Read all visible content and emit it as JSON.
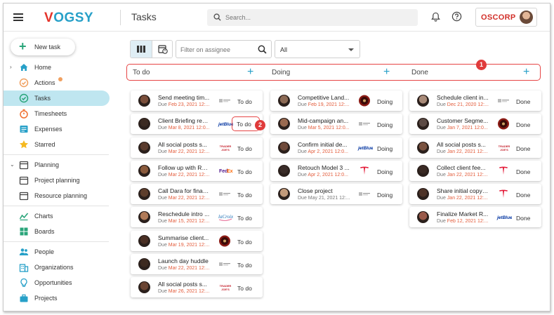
{
  "app": {
    "logo": {
      "first": "V",
      "rest": "OGSY"
    },
    "page_title": "Tasks",
    "search_placeholder": "Search...",
    "company": "OSCORP",
    "colors": {
      "accent": "#27a0c8",
      "brand_red": "#e4332a",
      "active_nav": "#bfe6f0",
      "overdue": "#e35b3a",
      "callout": "#e64545"
    }
  },
  "sidebar": {
    "new_task": "New task",
    "groups": [
      {
        "items": [
          {
            "label": "Home",
            "icon": "home-icon",
            "chevron": "›"
          },
          {
            "label": "Actions",
            "icon": "actions-icon",
            "dot": true
          },
          {
            "label": "Tasks",
            "icon": "tasks-check-icon",
            "active": true
          },
          {
            "label": "Timesheets",
            "icon": "stopwatch-icon"
          },
          {
            "label": "Expenses",
            "icon": "expenses-icon"
          },
          {
            "label": "Starred",
            "icon": "star-icon"
          }
        ]
      },
      {
        "items": [
          {
            "label": "Planning",
            "icon": "calendar-icon",
            "chevron": "⌄"
          },
          {
            "label": "Project planning",
            "icon": "calendar-icon"
          },
          {
            "label": "Resource planning",
            "icon": "calendar-icon"
          }
        ]
      },
      {
        "items": [
          {
            "label": "Charts",
            "icon": "charts-icon"
          },
          {
            "label": "Boards",
            "icon": "boards-icon"
          }
        ]
      },
      {
        "items": [
          {
            "label": "People",
            "icon": "people-icon"
          },
          {
            "label": "Organizations",
            "icon": "organizations-icon"
          },
          {
            "label": "Opportunities",
            "icon": "lightbulb-icon"
          },
          {
            "label": "Projects",
            "icon": "briefcase-icon"
          }
        ]
      }
    ]
  },
  "toolbar": {
    "assignee_placeholder": "Filter on assignee",
    "status_value": "All"
  },
  "columns": [
    {
      "title": "To do",
      "add": "+",
      "cards": [
        {
          "title": "Send meeting tim...",
          "due_label": "Due ",
          "due": "Feb 23, 2021 12:...",
          "status": "To do",
          "avatar": "#7a4e3a",
          "org": "generic"
        },
        {
          "title": "Client Briefing rea...",
          "due_label": "Due ",
          "due": "Mar 8, 2021 12:0...",
          "status": "To do",
          "avatar": "#3b2a22",
          "org": "jetblue",
          "highlight": true
        },
        {
          "title": "All social posts s...",
          "due_label": "Due ",
          "due": "Mar 22, 2021 12:...",
          "status": "To do",
          "avatar": "#5a3b2d",
          "org": "traderjoes"
        },
        {
          "title": "Follow up with Ra...",
          "due_label": "Due ",
          "due": "Mar 22, 2021 12:...",
          "status": "To do",
          "avatar": "#8a5a3c",
          "org": "fedex"
        },
        {
          "title": "Call Dara for final ...",
          "due_label": "Due ",
          "due": "Mar 22, 2021 12:...",
          "status": "To do",
          "avatar": "#5e3e2c",
          "org": "generic"
        },
        {
          "title": "Reschedule intro ...",
          "due_label": "Due ",
          "due": "Mar 15, 2021 12:...",
          "status": "To do",
          "avatar": "#b07a58",
          "org": "lacroix"
        },
        {
          "title": "Summarise client...",
          "due_label": "Due ",
          "due": "Mar 19, 2021 12:...",
          "status": "To do",
          "avatar": "#4a2f24",
          "org": "chipotle"
        },
        {
          "title": "Launch day huddle",
          "due_label": "Due ",
          "due": "Mar 22, 2021 12:...",
          "status": "To do",
          "avatar": "#3d2a20",
          "org": "generic"
        },
        {
          "title": "All social posts s...",
          "due_label": "Due ",
          "due": "Mar 26, 2021 12:...",
          "status": "To do",
          "avatar": "#6a4433",
          "org": "traderjoes"
        }
      ]
    },
    {
      "title": "Doing",
      "add": "+",
      "cards": [
        {
          "title": "Competitive Land...",
          "due_label": "Due ",
          "due": "Feb 19, 2021 12:...",
          "status": "Doing",
          "avatar": "#8c6a55",
          "org": "chipotle"
        },
        {
          "title": "Mid-campaign an...",
          "due_label": "Due ",
          "due": "Mar 5, 2021 12:0...",
          "status": "Doing",
          "avatar": "#9a6a50",
          "org": "generic"
        },
        {
          "title": "Confirm initial de...",
          "due_label": "Due ",
          "due": "Apr 2, 2021 12:0...",
          "status": "Doing",
          "avatar": "#6f4a3a",
          "org": "jetblue"
        },
        {
          "title": "Retouch Model 3 ...",
          "due_label": "Due ",
          "due": "Apr 2, 2021 12:0...",
          "status": "Doing",
          "avatar": "#3a2c28",
          "org": "tesla"
        },
        {
          "title": "Close project",
          "due_label": "Due ",
          "due": "May 21, 2021 12:...",
          "status": "Doing",
          "avatar": "#c29a7a",
          "org": "generic",
          "not_overdue": true
        }
      ]
    },
    {
      "title": "Done",
      "add": "+",
      "cards": [
        {
          "title": "Schedule client in...",
          "due_label": "Due ",
          "due": "Dec 21, 2020 12:...",
          "status": "Done",
          "avatar": "#a88a78",
          "org": "generic"
        },
        {
          "title": "Customer Segme...",
          "due_label": "Due ",
          "due": "Jan 7, 2021 12:0...",
          "status": "Done",
          "avatar": "#5c4a44",
          "org": "chipotle"
        },
        {
          "title": "All social posts s...",
          "due_label": "Due ",
          "due": "Jan 22, 2021 12:...",
          "status": "Done",
          "avatar": "#7a5240",
          "org": "traderjoes"
        },
        {
          "title": "Collect client fee...",
          "due_label": "Due ",
          "due": "Jan 22, 2021 12:...",
          "status": "Done",
          "avatar": "#3a2a24",
          "org": "tesla"
        },
        {
          "title": "Share initial copy ...",
          "due_label": "Due ",
          "due": "Jan 22, 2021 12:...",
          "status": "Done",
          "avatar": "#4e3328",
          "org": "tesla"
        },
        {
          "title": "Finalize Market R...",
          "due_label": "Due ",
          "due": "Feb 12, 2021 12:...",
          "status": "Done",
          "avatar": "#9a5a4a",
          "org": "jetblue"
        }
      ]
    }
  ],
  "callouts": [
    "1",
    "2"
  ]
}
